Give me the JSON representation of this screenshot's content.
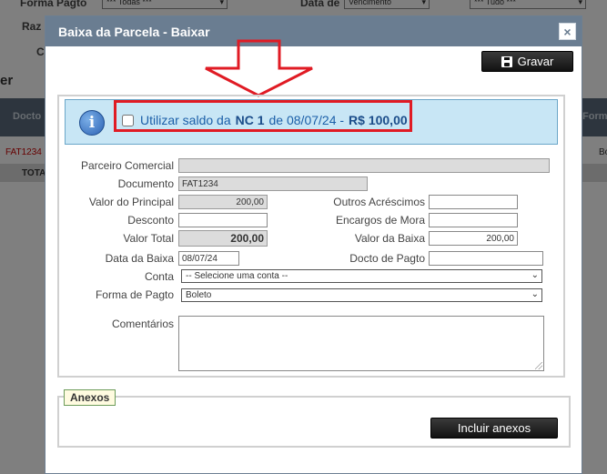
{
  "background": {
    "forma_pagto_label": "Forma Pagto",
    "forma_pagto_value": "*** Todas ***",
    "data_de_label": "Data de",
    "data_de_value": "Vencimento",
    "tudo_value": "*** Tudo ***",
    "razao_label": "Raz",
    "c_label": "C",
    "er_label": "er",
    "docto_header": "Docto",
    "form_header": "Form",
    "row_doc": "FAT1234",
    "row_bo": "Bo",
    "total_label": "TOTA"
  },
  "dialog": {
    "title": "Baixa da Parcela - Baixar",
    "close_label": "×",
    "gravar_label": "Gravar",
    "info": {
      "icon_glyph": "i",
      "text_prefix": "Utilizar saldo da",
      "nc": "NC 1",
      "text_mid": "de 08/07/24 -",
      "amount": "R$ 100,00"
    },
    "fields": {
      "parceiro_label": "Parceiro Comercial",
      "parceiro_value": "",
      "documento_label": "Documento",
      "documento_value": "FAT1234",
      "valor_principal_label": "Valor do Principal",
      "valor_principal_value": "200,00",
      "outros_acrescimos_label": "Outros Acréscimos",
      "outros_acrescimos_value": "",
      "desconto_label": "Desconto",
      "desconto_value": "",
      "encargos_label": "Encargos de Mora",
      "encargos_value": "",
      "valor_total_label": "Valor Total",
      "valor_total_value": "200,00",
      "valor_baixa_label": "Valor da Baixa",
      "valor_baixa_value": "200,00",
      "data_baixa_label": "Data da Baixa",
      "data_baixa_value": "08/07/24",
      "docto_pagto_label": "Docto de Pagto",
      "docto_pagto_value": "",
      "conta_label": "Conta",
      "conta_value": "-- Selecione uma conta --",
      "forma_pagto_label": "Forma de Pagto",
      "forma_pagto_value": "Boleto",
      "comentarios_label": "Comentários",
      "comentarios_value": ""
    },
    "anexos": {
      "legend": "Anexos",
      "incluir_label": "Incluir anexos"
    }
  },
  "colors": {
    "titlebar": "#6a7d91",
    "info_bg": "#c8e6f5",
    "highlight_red": "#e01b24",
    "link_blue": "#1b5fa8"
  }
}
